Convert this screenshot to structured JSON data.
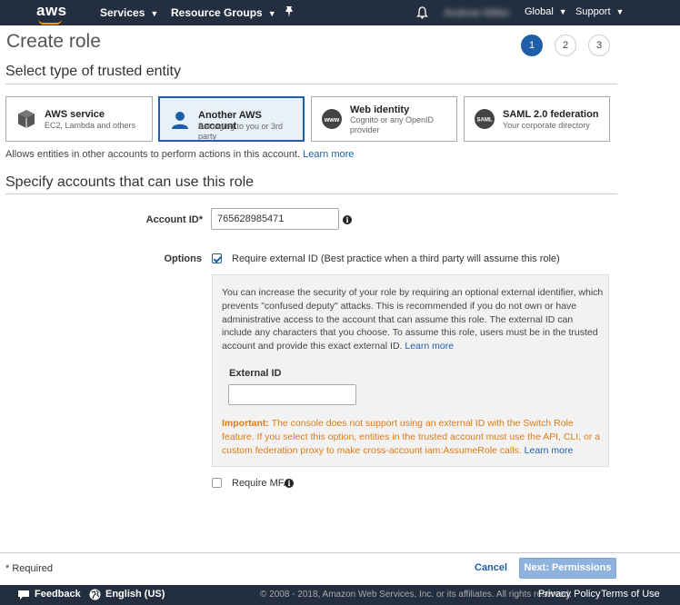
{
  "topbar": {
    "logo": "aws",
    "services_label": "Services",
    "resource_groups_label": "Resource Groups",
    "global_label": "Global",
    "support_label": "Support",
    "user_label": "Andrew Miller"
  },
  "page": {
    "title": "Create role",
    "steps": [
      "1",
      "2",
      "3"
    ],
    "active_step": "1"
  },
  "trusted_entity": {
    "heading": "Select type of trusted entity",
    "options": [
      {
        "title": "AWS service",
        "subtitle": "EC2, Lambda and others",
        "icon": "cube-icon"
      },
      {
        "title": "Another AWS account",
        "subtitle": "Belonging to you or 3rd party",
        "icon": "user-icon",
        "selected": true
      },
      {
        "title": "Web identity",
        "subtitle": "Cognito or any OpenID provider",
        "icon": "www-icon"
      },
      {
        "title": "SAML 2.0 federation",
        "subtitle": "Your corporate directory",
        "icon": "saml-icon"
      }
    ],
    "note": "Allows entities in other accounts to perform actions in this account.",
    "learn_more": "Learn more"
  },
  "accounts": {
    "heading": "Specify accounts that can use this role",
    "account_id_label": "Account ID*",
    "account_id_value": "765628985471",
    "options_label": "Options",
    "require_external_id_label": "Require external ID (Best practice when a third party will assume this role)",
    "info_text": "You can increase the security of your role by requiring an optional external identifier, which prevents \"confused deputy\" attacks. This is recommended if you do not own or have administrative access to the account that can assume this role. The external ID can include any characters that you choose. To assume this role, users must be in the trusted account and provide this exact external ID.",
    "info_learn_more": "Learn more",
    "external_id_label": "External ID",
    "external_id_value": "",
    "important_label": "Important:",
    "important_text": "The console does not support using an external ID with the Switch Role feature. If you select this option, entities in the trusted account must use the API, CLI, or a custom federation proxy to make cross-account iam:AssumeRole calls.",
    "important_learn_more": "Learn more",
    "require_mfa_label": "Require MFA"
  },
  "footer": {
    "required_note": "* Required",
    "cancel_label": "Cancel",
    "next_label": "Next: Permissions"
  },
  "bottombar": {
    "feedback": "Feedback",
    "language": "English (US)",
    "copyright": "© 2008 - 2018, Amazon Web Services, Inc. or its affiliates. All rights reserved.",
    "privacy": "Privacy Policy",
    "terms": "Terms of Use"
  },
  "colors": {
    "nav_bg": "#232f3e",
    "accent": "#1f5ea8",
    "warning": "#e07b14",
    "smile": "#ff9900"
  }
}
